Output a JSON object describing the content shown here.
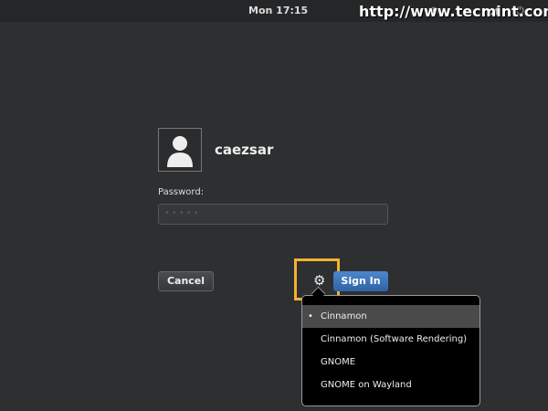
{
  "topbar": {
    "clock": "Mon 17:15",
    "watermark": "http://www.tecmint.com"
  },
  "user": {
    "name": "caezsar"
  },
  "password": {
    "label": "Password:",
    "value": "•••••"
  },
  "buttons": {
    "cancel": "Cancel",
    "sign_in": "Sign In"
  },
  "session_menu": {
    "items": [
      {
        "label": "Cinnamon",
        "selected": true,
        "bullet": "•"
      },
      {
        "label": "Cinnamon (Software Rendering)"
      },
      {
        "label": "GNOME"
      },
      {
        "label": "GNOME on Wayland"
      }
    ]
  },
  "colors": {
    "accent": "#2f63a6",
    "highlight": "#f3b233"
  }
}
